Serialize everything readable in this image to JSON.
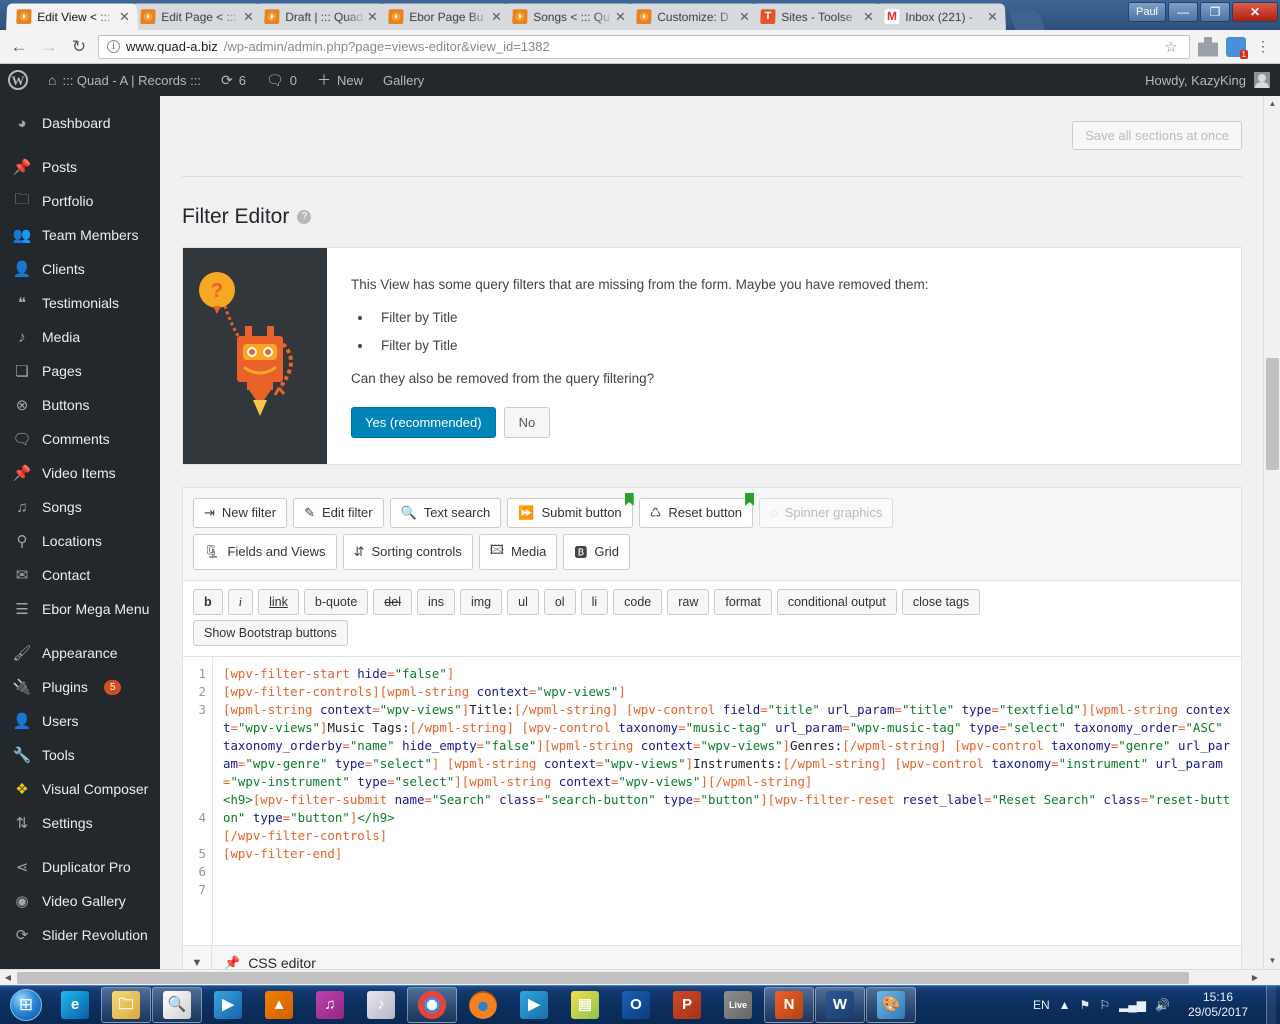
{
  "browser": {
    "tabs": [
      {
        "title": "Edit View < :::",
        "favicon": "wordpress-icon",
        "active": true
      },
      {
        "title": "Edit Page < :::",
        "favicon": "wordpress-icon",
        "active": false
      },
      {
        "title": "Draft | ::: Quad",
        "favicon": "wordpress-icon",
        "active": false
      },
      {
        "title": "Ebor Page Bu",
        "favicon": "wordpress-icon",
        "active": false
      },
      {
        "title": "Songs < ::: Qu",
        "favicon": "wordpress-icon",
        "active": false
      },
      {
        "title": "Customize: D",
        "favicon": "wordpress-icon",
        "active": false
      },
      {
        "title": "Sites - Toolse",
        "favicon": "toolset-icon",
        "active": false
      },
      {
        "title": "Inbox (221) -",
        "favicon": "gmail-icon",
        "active": false
      }
    ],
    "close_label": "✕",
    "window": {
      "user": "Paul",
      "minimize": "—",
      "maximize": "❐",
      "close": "✕"
    },
    "nav": {
      "back": "←",
      "forward": "→",
      "reload": "↻"
    },
    "url": {
      "host": "www.quad-a.biz",
      "path": "/wp-admin/admin.php?page=views-editor&view_id=1382"
    },
    "star": "☆",
    "menu": "⋮"
  },
  "adminbar": {
    "site_name": "::: Quad - A | Records :::",
    "updates_count": "6",
    "comments_count": "0",
    "new_label": "New",
    "gallery_label": "Gallery",
    "howdy": "Howdy, KazyKing"
  },
  "sidebar": {
    "items": [
      {
        "label": "Dashboard",
        "icon": "gauge-icon",
        "sep_after": true
      },
      {
        "label": "Posts",
        "icon": "pin-icon"
      },
      {
        "label": "Portfolio",
        "icon": "folder-icon"
      },
      {
        "label": "Team Members",
        "icon": "group-icon"
      },
      {
        "label": "Clients",
        "icon": "person-icon"
      },
      {
        "label": "Testimonials",
        "icon": "quote-icon"
      },
      {
        "label": "Media",
        "icon": "media-icon"
      },
      {
        "label": "Pages",
        "icon": "pages-icon"
      },
      {
        "label": "Buttons",
        "icon": "button-icon"
      },
      {
        "label": "Comments",
        "icon": "comment-icon"
      },
      {
        "label": "Video Items",
        "icon": "pin-icon"
      },
      {
        "label": "Songs",
        "icon": "music-icon"
      },
      {
        "label": "Locations",
        "icon": "location-icon"
      },
      {
        "label": "Contact",
        "icon": "envelope-icon"
      },
      {
        "label": "Ebor Mega Menu",
        "icon": "menu-icon",
        "sep_after": true
      },
      {
        "label": "Appearance",
        "icon": "brush-icon"
      },
      {
        "label": "Plugins",
        "icon": "plug-icon",
        "badge": "5"
      },
      {
        "label": "Users",
        "icon": "users-icon"
      },
      {
        "label": "Tools",
        "icon": "wrench-icon"
      },
      {
        "label": "Visual Composer",
        "icon": "vc-icon"
      },
      {
        "label": "Settings",
        "icon": "sliders-icon",
        "sep_after": true
      },
      {
        "label": "Duplicator Pro",
        "icon": "share-icon"
      },
      {
        "label": "Video Gallery",
        "icon": "video-icon"
      },
      {
        "label": "Slider Revolution",
        "icon": "refresh-icon"
      }
    ]
  },
  "main": {
    "save_all_label": "Save all sections at once",
    "section_title": "Filter Editor",
    "notice": {
      "intro": "This View has some query filters that are missing from the form. Maybe you have removed them:",
      "items": [
        "Filter by Title",
        "Filter by Title"
      ],
      "question": "Can they also be removed from the query filtering?",
      "yes_label": "Yes (recommended)",
      "no_label": "No"
    },
    "toolbar_row1": [
      {
        "label": "New filter",
        "icon": "new-filter-icon",
        "flag": false,
        "disabled": false
      },
      {
        "label": "Edit filter",
        "icon": "edit-filter-icon",
        "flag": false,
        "disabled": false
      },
      {
        "label": "Text search",
        "icon": "text-search-icon",
        "flag": false,
        "disabled": false
      },
      {
        "label": "Submit button",
        "icon": "submit-icon",
        "flag": true,
        "disabled": false
      },
      {
        "label": "Reset button",
        "icon": "reset-icon",
        "flag": true,
        "disabled": false
      },
      {
        "label": "Spinner graphics",
        "icon": "spinner-icon",
        "flag": false,
        "disabled": true
      }
    ],
    "toolbar_row2": [
      {
        "label": "Fields and Views",
        "icon": "fields-views-icon"
      },
      {
        "label": "Sorting controls",
        "icon": "sorting-icon"
      },
      {
        "label": "Media",
        "icon": "media-icon"
      },
      {
        "label": "Grid",
        "icon": "grid-icon"
      }
    ],
    "quicktags": [
      "b",
      "i",
      "link",
      "b-quote",
      "del",
      "ins",
      "img",
      "ul",
      "ol",
      "li",
      "code",
      "raw",
      "format",
      "conditional output",
      "close tags"
    ],
    "bootstrap_label": "Show Bootstrap buttons",
    "code": {
      "line_numbers": [
        "1",
        "2",
        "3",
        "4",
        "5",
        "6",
        "7"
      ],
      "lines": [
        [
          {
            "t": "tag",
            "s": "[wpv-filter-start "
          },
          {
            "t": "attr",
            "s": "hide"
          },
          {
            "t": "tag",
            "s": "="
          },
          {
            "t": "val",
            "s": "\"false\""
          },
          {
            "t": "tag",
            "s": "]"
          }
        ],
        [
          {
            "t": "tag",
            "s": "[wpv-filter-controls][wpml-string "
          },
          {
            "t": "attr",
            "s": "context"
          },
          {
            "t": "tag",
            "s": "="
          },
          {
            "t": "val",
            "s": "\"wpv-views\""
          },
          {
            "t": "tag",
            "s": "]"
          }
        ],
        [
          {
            "t": "tag",
            "s": "[wpml-string "
          },
          {
            "t": "attr",
            "s": "context"
          },
          {
            "t": "tag",
            "s": "="
          },
          {
            "t": "val",
            "s": "\"wpv-views\""
          },
          {
            "t": "tag",
            "s": "]"
          },
          {
            "t": "txt",
            "s": "Title:"
          },
          {
            "t": "tag",
            "s": "[/wpml-string]"
          },
          {
            "t": "txt",
            "s": " "
          },
          {
            "t": "tag",
            "s": "[wpv-control "
          },
          {
            "t": "attr",
            "s": "field"
          },
          {
            "t": "tag",
            "s": "="
          },
          {
            "t": "val",
            "s": "\"title\""
          },
          {
            "t": "txt",
            "s": " "
          },
          {
            "t": "attr",
            "s": "url_param"
          },
          {
            "t": "tag",
            "s": "="
          },
          {
            "t": "val",
            "s": "\"title\""
          },
          {
            "t": "txt",
            "s": " "
          },
          {
            "t": "attr",
            "s": "type"
          },
          {
            "t": "tag",
            "s": "="
          },
          {
            "t": "val",
            "s": "\"textfield\""
          },
          {
            "t": "tag",
            "s": "][wpml-string "
          },
          {
            "t": "attr",
            "s": "context"
          },
          {
            "t": "tag",
            "s": "="
          },
          {
            "t": "val",
            "s": "\"wpv-views\""
          },
          {
            "t": "tag",
            "s": "]"
          },
          {
            "t": "txt",
            "s": "Music Tags:"
          },
          {
            "t": "tag",
            "s": "[/wpml-string]"
          },
          {
            "t": "txt",
            "s": " "
          },
          {
            "t": "tag",
            "s": "[wpv-control "
          },
          {
            "t": "attr",
            "s": "taxonomy"
          },
          {
            "t": "tag",
            "s": "="
          },
          {
            "t": "val",
            "s": "\"music-tag\""
          },
          {
            "t": "txt",
            "s": " "
          },
          {
            "t": "attr",
            "s": "url_param"
          },
          {
            "t": "tag",
            "s": "="
          },
          {
            "t": "val",
            "s": "\"wpv-music-tag\""
          },
          {
            "t": "txt",
            "s": " "
          },
          {
            "t": "attr",
            "s": "type"
          },
          {
            "t": "tag",
            "s": "="
          },
          {
            "t": "val",
            "s": "\"select\""
          },
          {
            "t": "txt",
            "s": " "
          },
          {
            "t": "attr",
            "s": "taxonomy_order"
          },
          {
            "t": "tag",
            "s": "="
          },
          {
            "t": "val",
            "s": "\"ASC\""
          },
          {
            "t": "txt",
            "s": " "
          },
          {
            "t": "attr",
            "s": "taxonomy_orderby"
          },
          {
            "t": "tag",
            "s": "="
          },
          {
            "t": "val",
            "s": "\"name\""
          },
          {
            "t": "txt",
            "s": " "
          },
          {
            "t": "attr",
            "s": "hide_empty"
          },
          {
            "t": "tag",
            "s": "="
          },
          {
            "t": "val",
            "s": "\"false\""
          },
          {
            "t": "tag",
            "s": "][wpml-string "
          },
          {
            "t": "attr",
            "s": "context"
          },
          {
            "t": "tag",
            "s": "="
          },
          {
            "t": "val",
            "s": "\"wpv-views\""
          },
          {
            "t": "tag",
            "s": "]"
          },
          {
            "t": "txt",
            "s": "Genres:"
          },
          {
            "t": "tag",
            "s": "[/wpml-string]"
          },
          {
            "t": "txt",
            "s": " "
          },
          {
            "t": "tag",
            "s": "[wpv-control "
          },
          {
            "t": "attr",
            "s": "taxonomy"
          },
          {
            "t": "tag",
            "s": "="
          },
          {
            "t": "val",
            "s": "\"genre\""
          },
          {
            "t": "txt",
            "s": " "
          },
          {
            "t": "attr",
            "s": "url_param"
          },
          {
            "t": "tag",
            "s": "="
          },
          {
            "t": "val",
            "s": "\"wpv-genre\""
          },
          {
            "t": "txt",
            "s": " "
          },
          {
            "t": "attr",
            "s": "type"
          },
          {
            "t": "tag",
            "s": "="
          },
          {
            "t": "val",
            "s": "\"select\""
          },
          {
            "t": "tag",
            "s": "]"
          },
          {
            "t": "txt",
            "s": " "
          },
          {
            "t": "tag",
            "s": "[wpml-string "
          },
          {
            "t": "attr",
            "s": "context"
          },
          {
            "t": "tag",
            "s": "="
          },
          {
            "t": "val",
            "s": "\"wpv-views\""
          },
          {
            "t": "tag",
            "s": "]"
          },
          {
            "t": "txt",
            "s": "Instruments:"
          },
          {
            "t": "tag",
            "s": "[/wpml-string]"
          },
          {
            "t": "txt",
            "s": " "
          },
          {
            "t": "tag",
            "s": "[wpv-control "
          },
          {
            "t": "attr",
            "s": "taxonomy"
          },
          {
            "t": "tag",
            "s": "="
          },
          {
            "t": "val",
            "s": "\"instrument\""
          },
          {
            "t": "txt",
            "s": " "
          },
          {
            "t": "attr",
            "s": "url_param"
          },
          {
            "t": "tag",
            "s": "="
          },
          {
            "t": "val",
            "s": "\"wpv-instrument\""
          },
          {
            "t": "txt",
            "s": " "
          },
          {
            "t": "attr",
            "s": "type"
          },
          {
            "t": "tag",
            "s": "="
          },
          {
            "t": "val",
            "s": "\"select\""
          },
          {
            "t": "tag",
            "s": "][wpml-string "
          },
          {
            "t": "attr",
            "s": "context"
          },
          {
            "t": "tag",
            "s": "="
          },
          {
            "t": "val",
            "s": "\"wpv-views\""
          },
          {
            "t": "tag",
            "s": "][/wpml-string]"
          }
        ],
        [
          {
            "t": "html",
            "s": "<h9>"
          },
          {
            "t": "tag",
            "s": "[wpv-filter-submit "
          },
          {
            "t": "attr",
            "s": "name"
          },
          {
            "t": "tag",
            "s": "="
          },
          {
            "t": "val",
            "s": "\"Search\""
          },
          {
            "t": "txt",
            "s": " "
          },
          {
            "t": "attr",
            "s": "class"
          },
          {
            "t": "tag",
            "s": "="
          },
          {
            "t": "val",
            "s": "\"search-button\""
          },
          {
            "t": "txt",
            "s": " "
          },
          {
            "t": "attr",
            "s": "type"
          },
          {
            "t": "tag",
            "s": "="
          },
          {
            "t": "val",
            "s": "\"button\""
          },
          {
            "t": "tag",
            "s": "][wpv-filter-reset "
          },
          {
            "t": "attr",
            "s": "reset_label"
          },
          {
            "t": "tag",
            "s": "="
          },
          {
            "t": "val",
            "s": "\"Reset Search\""
          },
          {
            "t": "txt",
            "s": " "
          },
          {
            "t": "attr",
            "s": "class"
          },
          {
            "t": "tag",
            "s": "="
          },
          {
            "t": "val",
            "s": "\"reset-button\""
          },
          {
            "t": "txt",
            "s": " "
          },
          {
            "t": "attr",
            "s": "type"
          },
          {
            "t": "tag",
            "s": "="
          },
          {
            "t": "val",
            "s": "\"button\""
          },
          {
            "t": "tag",
            "s": "]"
          },
          {
            "t": "html",
            "s": "</h9>"
          }
        ],
        [
          {
            "t": "tag",
            "s": "[/wpv-filter-controls]"
          }
        ],
        [
          {
            "t": "tag",
            "s": "[wpv-filter-end]"
          }
        ],
        [
          {
            "t": "txt",
            "s": ""
          }
        ]
      ]
    },
    "css_editor_label": "CSS editor"
  },
  "taskbar": {
    "apps": [
      {
        "name": "internet-explorer-icon",
        "open": false
      },
      {
        "name": "file-explorer-icon",
        "open": true
      },
      {
        "name": "search-file-icon",
        "open": true
      },
      {
        "name": "media-player-icon",
        "open": false
      },
      {
        "name": "vlc-icon",
        "open": false
      },
      {
        "name": "itunes-icon",
        "open": false
      },
      {
        "name": "music-presenter-icon",
        "open": false
      },
      {
        "name": "google-chrome-icon",
        "open": true
      },
      {
        "name": "firefox-icon",
        "open": false
      },
      {
        "name": "movie-maker-icon",
        "open": false
      },
      {
        "name": "sticky-notes-icon",
        "open": false
      },
      {
        "name": "outlook-icon",
        "open": false
      },
      {
        "name": "powerpoint-icon",
        "open": false
      },
      {
        "name": "live-icon",
        "open": false
      },
      {
        "name": "notepad-plus-icon",
        "open": true
      },
      {
        "name": "word-icon",
        "open": true
      },
      {
        "name": "paint-icon",
        "open": true
      }
    ],
    "language": "EN",
    "time": "15:16",
    "date": "29/05/2017"
  }
}
